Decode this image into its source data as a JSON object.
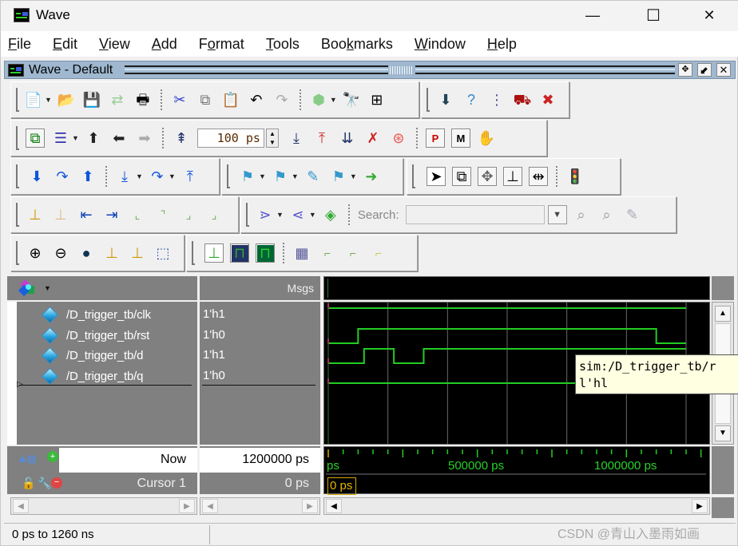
{
  "window": {
    "title": "Wave",
    "controls": {
      "minimize": "—",
      "maximize": "☐",
      "close": "✕"
    }
  },
  "menubar": [
    {
      "label": "File",
      "mnemonic": "F",
      "rest": "ile"
    },
    {
      "label": "Edit",
      "mnemonic": "E",
      "rest": "dit"
    },
    {
      "label": "View",
      "mnemonic": "V",
      "rest": "iew"
    },
    {
      "label": "Add",
      "mnemonic": "A",
      "rest": "dd"
    },
    {
      "label": "Format",
      "pre": "F",
      "mnemonic": "o",
      "rest": "rmat"
    },
    {
      "label": "Tools",
      "mnemonic": "T",
      "rest": "ools"
    },
    {
      "label": "Bookmarks",
      "pre": "Boo",
      "mnemonic": "k",
      "rest": "marks"
    },
    {
      "label": "Window",
      "mnemonic": "W",
      "rest": "indow"
    },
    {
      "label": "Help",
      "mnemonic": "H",
      "rest": "elp"
    }
  ],
  "subwindow": {
    "title": "Wave - Default",
    "buttons": {
      "float": "✥",
      "dock": "⬋",
      "close": "✕"
    }
  },
  "toolbar": {
    "zoom_step_value": "100 ps",
    "search_label": "Search:",
    "search_value": ""
  },
  "wave": {
    "msgs_header": "Msgs",
    "signals": [
      {
        "name": "/D_trigger_tb/clk",
        "value": "1'h1"
      },
      {
        "name": "/D_trigger_tb/rst",
        "value": "1'h0"
      },
      {
        "name": "/D_trigger_tb/d",
        "value": "1'h1"
      },
      {
        "name": "/D_trigger_tb/q",
        "value": "1'h0"
      }
    ],
    "now_label": "Now",
    "now_value": "1200000 ps",
    "cursor_label": "Cursor 1",
    "cursor_value": "0 ps",
    "cursor_marker": "0 ps",
    "timeline_labels": [
      "ps",
      "500000 ps",
      "1000000 ps"
    ],
    "tooltip_line1": "sim:/D_trigger_tb/r",
    "tooltip_line2": "l'hl",
    "waveform_color": "#22cc22"
  },
  "status": {
    "range": "0 ps to 1260 ns"
  },
  "watermark": "CSDN @青山入墨雨如画"
}
